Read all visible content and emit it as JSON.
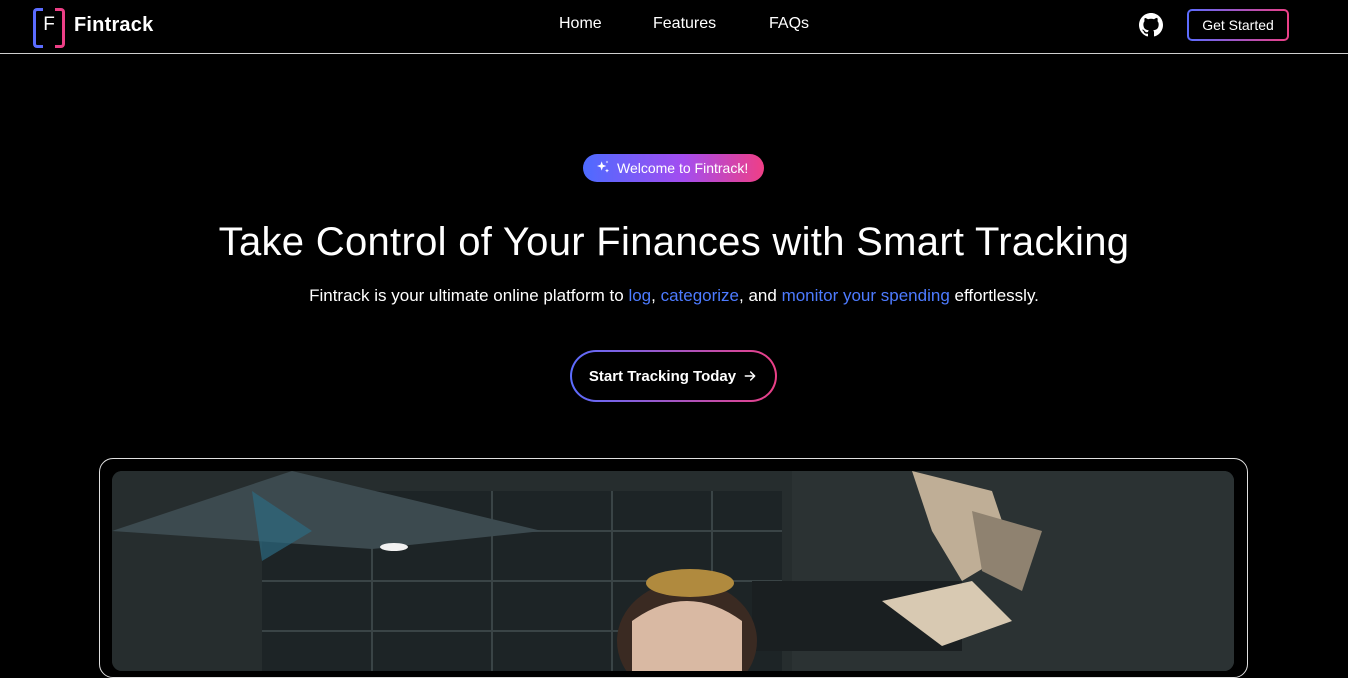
{
  "brand": {
    "mark": "F",
    "name": "Fintrack"
  },
  "nav": {
    "home": "Home",
    "features": "Features",
    "faqs": "FAQs"
  },
  "header": {
    "github_icon": "github-icon",
    "get_started": "Get Started"
  },
  "hero": {
    "badge_icon": "sparkles-icon",
    "badge": "Welcome to Fintrack!",
    "title": "Take Control of Your Finances with Smart Tracking",
    "subtitle": {
      "pre": "Fintrack is your ultimate online platform to ",
      "hl1": "log",
      "sep1": ", ",
      "hl2": "categorize",
      "sep2": ", and ",
      "hl3": "monitor your spending",
      "post": " effortlessly."
    },
    "cta": "Start Tracking Today",
    "cta_icon": "arrow-right-icon"
  },
  "colors": {
    "gradient_start": "#5b6cff",
    "gradient_end": "#ec3f86",
    "highlight": "#4d7bff",
    "background": "#000000"
  }
}
